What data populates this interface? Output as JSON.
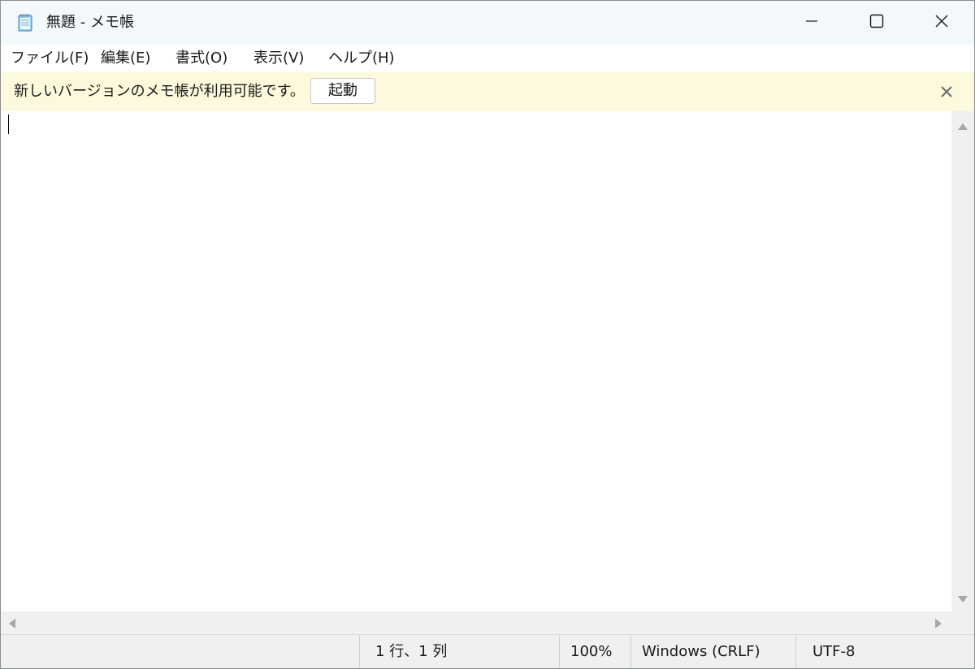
{
  "window": {
    "title": "無題 - メモ帳"
  },
  "menu": {
    "items": [
      {
        "label": "ファイル(F)"
      },
      {
        "label": "編集(E)"
      },
      {
        "label": "書式(O)"
      },
      {
        "label": "表示(V)"
      },
      {
        "label": "ヘルプ(H)"
      }
    ]
  },
  "notification": {
    "message": "新しいバージョンのメモ帳が利用可能です。",
    "button_label": "起動"
  },
  "editor": {
    "content": ""
  },
  "statusbar": {
    "position": "1 行、1 列",
    "zoom": "100%",
    "line_ending": "Windows (CRLF)",
    "encoding": "UTF-8"
  },
  "colors": {
    "titlebar": "#f3f8fb",
    "notification_bg": "#fcf9dc",
    "statusbar": "#f0f0f0"
  },
  "icons": {
    "app": "notepad-icon",
    "minimize": "minimize-icon",
    "maximize": "maximize-icon",
    "close": "close-icon",
    "notify_close": "close-icon"
  }
}
